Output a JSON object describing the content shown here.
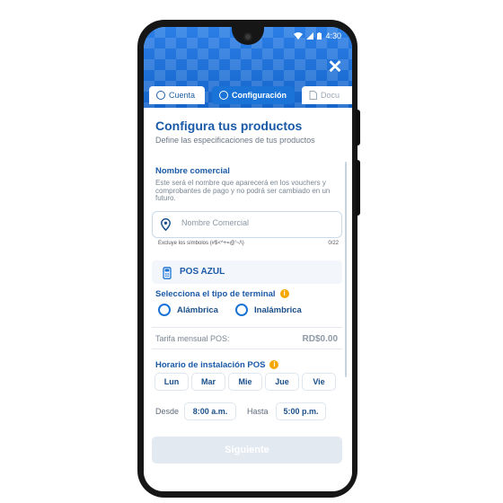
{
  "status_bar": {
    "time": "4:30"
  },
  "tabs": [
    {
      "label": "Cuenta",
      "icon": "dollar-icon"
    },
    {
      "label": "Configuración",
      "icon": "settings-icon",
      "active": true
    },
    {
      "label": "Docu",
      "icon": "document-icon"
    }
  ],
  "header": {
    "title": "Configura tus productos",
    "subtitle": "Define las especificaciones de tus productos"
  },
  "commercial_name": {
    "label": "Nombre comercial",
    "description": "Este será el nombre que aparecerá en los vouchers y comprobantes de pago y no podrá ser cambiado en un futuro.",
    "placeholder": "Nombre Comercial",
    "value": "",
    "hint": "Excluye los símbolos (#$<^+=@'~/\\)",
    "counter": "0/22"
  },
  "pos": {
    "title": "POS AZUL",
    "terminal_label": "Selecciona el tipo de terminal",
    "options": [
      "Alámbrica",
      "Inalámbrica"
    ],
    "fee_label": "Tarifa mensual POS:",
    "fee_value": "RD$0.00"
  },
  "schedule": {
    "label": "Horario de instalación POS",
    "days": [
      "Lun",
      "Mar",
      "Mie",
      "Jue",
      "Vie"
    ],
    "from_label": "Desde",
    "from_value": "8:00 a.m.",
    "to_label": "Hasta",
    "to_value": "5:00 p.m."
  },
  "next_button": "Siguiente",
  "colors": {
    "brand": "#1a73d6",
    "title": "#1a5aa8",
    "info": "#f5a700"
  }
}
